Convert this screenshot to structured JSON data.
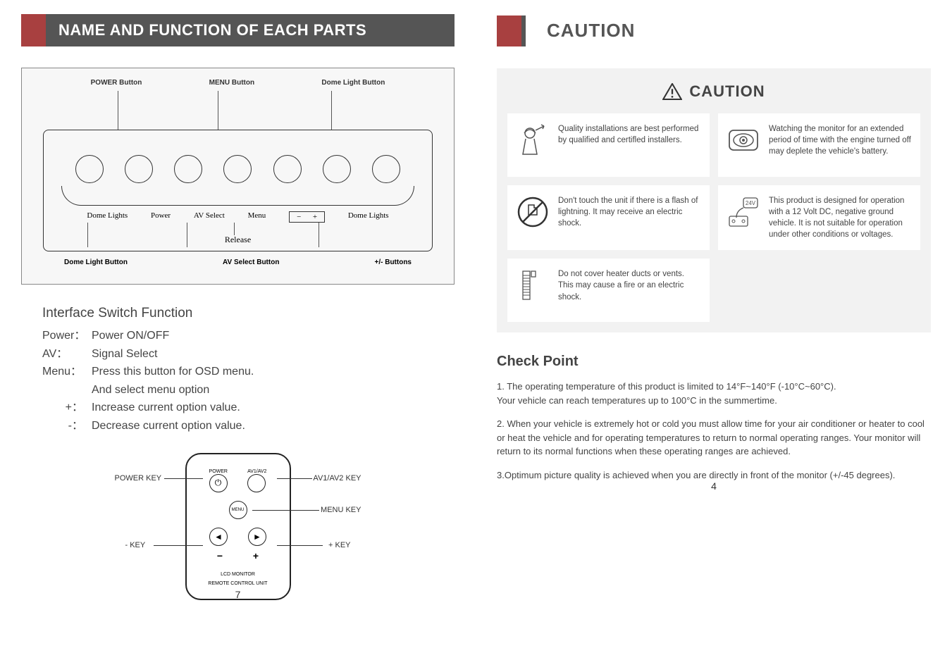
{
  "left_header": "NAME AND FUNCTION OF EACH PARTS",
  "right_header": "CAUTION",
  "diagram": {
    "top_labels": {
      "power": "POWER Button",
      "menu": "MENU Button",
      "dome": "Dome Light Button"
    },
    "btn_labels": {
      "dome_l": "Dome Lights",
      "power": "Power",
      "av": "AV Select",
      "menu": "Menu",
      "minus": "−",
      "plus": "+",
      "dome_r": "Dome Lights"
    },
    "release": "Release",
    "bottom_labels": {
      "dome": "Dome Light Button",
      "av": "AV Select Button",
      "pm": "+/- Buttons"
    }
  },
  "switch": {
    "title": "Interface Switch Function",
    "rows": {
      "power": {
        "key": "Power：",
        "val": "Power ON/OFF"
      },
      "av": {
        "key": "AV：",
        "val": "Signal Select"
      },
      "menu1": {
        "key": "Menu：",
        "val": "Press this button for OSD menu."
      },
      "menu2": {
        "key": "",
        "val": "And select menu option"
      },
      "plus": {
        "key": "+：",
        "val": "Increase current option value."
      },
      "minus": {
        "key": "-：",
        "val": "Decrease current option value."
      }
    }
  },
  "remote": {
    "tiny": {
      "power": "POWER",
      "av": "AV1/AV2",
      "menu": "MENU"
    },
    "side": {
      "power": "POWER KEY",
      "av": "AV1/AV2 KEY",
      "menu": "MENU KEY",
      "minus": "- KEY",
      "plus": "+ KEY"
    },
    "bottom1": "LCD MONITOR",
    "bottom2": "REMOTE CONTROL UNIT",
    "pm": {
      "minus": "−",
      "plus": "+"
    }
  },
  "page_left": "7",
  "page_right": "4",
  "caution_panel": {
    "title": "CAUTION",
    "cards": {
      "install": "Quality installations are best performed by qualified and certifled installers.",
      "watch": "Watching the monitor for an extended period of time with the engine turned off may deplete the vehicle's battery.",
      "touch": "Don't touch the unit if there is a flash of lightning. It may receive an electric shock.",
      "volt": "This product is designed for operation with a 12 Volt DC, negative ground vehicle. It is not suitable for operation under other conditions or voltages.",
      "heater": "Do not cover heater ducts or vents. This may cause a fire or an electric shock."
    },
    "volt_badge": "24V"
  },
  "check": {
    "title": "Check Point",
    "p1": "1. The operating temperature of this product is limited to 14°F~140°F (-10°C~60°C).",
    "p1b": "Your vehicle can reach temperatures up to 100°C in the summertime.",
    "p2": "2. When your vehicle is extremely hot or cold you must allow time for your air conditioner or heater to cool or heat the vehicle and for operating temperatures to return to normal operating ranges. Your monitor will return to its normal functions when these operating ranges are achieved.",
    "p3": "3.Optimum picture quality is achieved when you are directly in front of the monitor (+/-45 degrees)."
  }
}
